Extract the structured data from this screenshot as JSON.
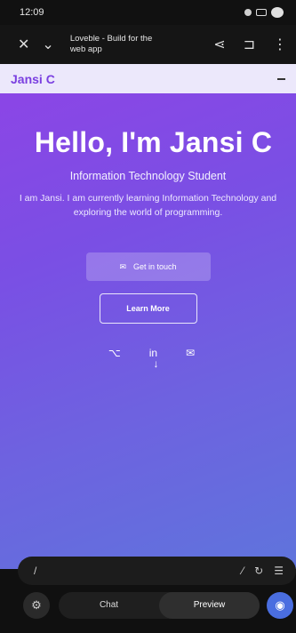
{
  "status_bar": {
    "time": "12:09"
  },
  "app_bar": {
    "title": "Loveble - Build for the",
    "subtitle": "web app"
  },
  "site": {
    "brand": "Jansi C",
    "hero_title": "Hello, I'm Jansi C",
    "subtitle": "Information Technology Student",
    "description": "I am Jansi. I am currently learning Information Technology and exploring the world of programming.",
    "primary_button": "Get in touch",
    "secondary_button": "Learn More"
  },
  "bottom": {
    "chat_label": "Chat",
    "preview_label": "Preview"
  }
}
